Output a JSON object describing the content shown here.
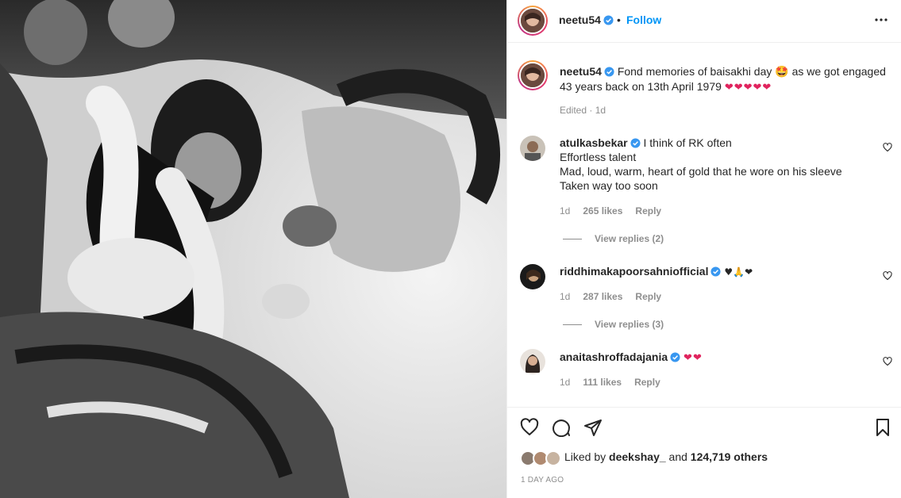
{
  "post": {
    "author": "neetu54",
    "follow_label": "Follow",
    "separator": "•",
    "caption": "Fond memories of baisakhi day",
    "caption_emoji": "🤩",
    "caption_cont": "as we got engaged 43 years back on 13th April 1979",
    "caption_hearts": "❤❤❤❤❤",
    "edited": "Edited · 1d"
  },
  "comments": [
    {
      "username": "atulkasbekar",
      "text": "I think of RK often\nEffortless talent\nMad, loud, warm, heart of gold that he wore on his sleeve\nTaken way too soon",
      "time": "1d",
      "likes": "265 likes",
      "reply": "Reply",
      "view_replies": "View replies (2)"
    },
    {
      "username": "riddhimakapoorsahniofficial",
      "text": "♥🙏❤",
      "time": "1d",
      "likes": "287 likes",
      "reply": "Reply",
      "view_replies": "View replies (3)"
    },
    {
      "username": "anaitashroffadajania",
      "text": "❤❤",
      "time": "1d",
      "likes": "111 likes",
      "reply": "Reply"
    }
  ],
  "footer": {
    "liked_by_prefix": "Liked by",
    "liked_by_user": "deekshay_",
    "liked_by_and": "and",
    "liked_by_count": "124,719 others",
    "time_ago": "1 DAY AGO"
  },
  "icons": {
    "like": "heart-outline-icon",
    "comment": "comment-icon",
    "share": "send-icon",
    "save": "bookmark-icon",
    "more": "more-options-icon",
    "verified": "verified-badge-icon"
  },
  "colors": {
    "accent": "#0095f6",
    "text": "#262626",
    "muted": "#8e8e8e",
    "heart": "#e0245e",
    "verified": "#3897f0"
  }
}
